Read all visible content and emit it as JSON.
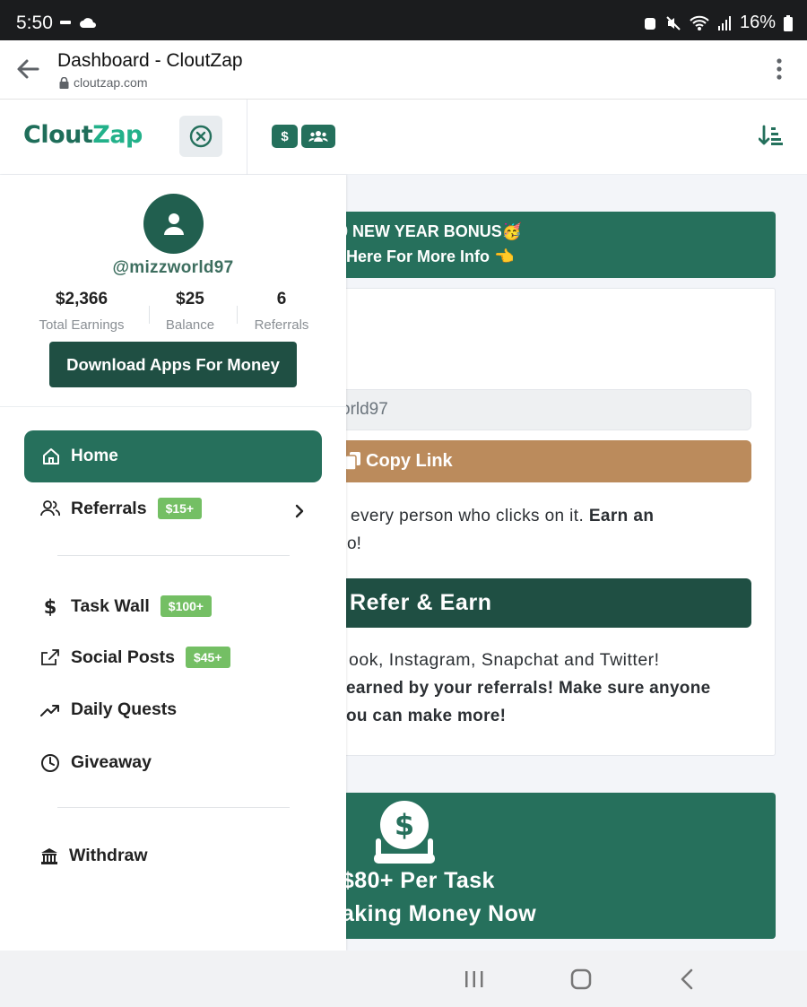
{
  "status_bar": {
    "time": "5:50",
    "battery": "16%"
  },
  "browser": {
    "title": "Dashboard - CloutZap",
    "url": "cloutzap.com"
  },
  "app_header": {
    "logo_part1": "Clout",
    "logo_part2": "Zap",
    "dollar_button": "$"
  },
  "sidebar": {
    "username": "@mizzworld97",
    "stats": [
      {
        "value": "$2,366",
        "label": "Total Earnings"
      },
      {
        "value": "$25",
        "label": "Balance"
      },
      {
        "value": "6",
        "label": "Referrals"
      }
    ],
    "download_button": "Download Apps For Money",
    "nav": {
      "home": "Home",
      "referrals": "Referrals",
      "referrals_badge": "$15+",
      "task_wall": "Task Wall",
      "task_wall_badge": "$100+",
      "social_posts": "Social Posts",
      "social_posts_badge": "$45+",
      "daily_quests": "Daily Quests",
      "giveaway": "Giveaway",
      "withdraw": "Withdraw"
    }
  },
  "main": {
    "banner_line1": "00 NEW YEAR BONUS🥳",
    "banner_line2": "Here For More Info 👈",
    "referral_input": "orld97",
    "copy_link": "Copy Link",
    "ref_text1_normal": "every person who clicks on it. ",
    "ref_text1_bold": "Earn an",
    "ref_text2": "o!",
    "refer_button": "Refer & Earn",
    "ref_text3": "ook, Instagram, Snapchat and Twitter!",
    "ref_text4": "earned by your referrals! Make sure anyone",
    "ref_text5": "ou can make more!",
    "task_line1": "$80+ Per Task",
    "task_line2": "aking Money Now"
  },
  "colors": {
    "brand_dark": "#1f4f43",
    "brand": "#26705c",
    "badge_green": "#74bf64",
    "copy_brown": "#bb8b5c"
  }
}
